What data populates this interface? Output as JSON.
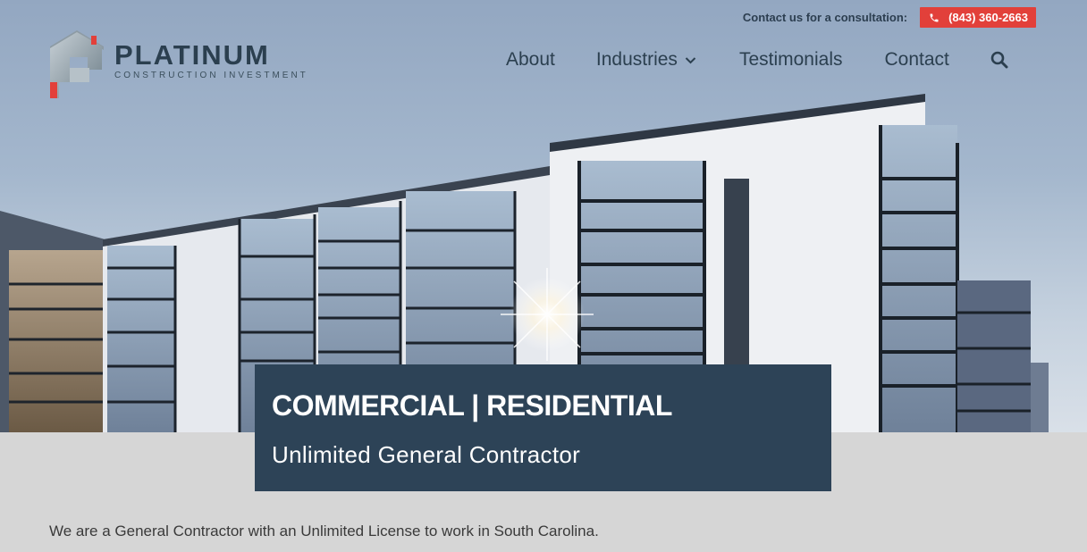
{
  "topbar": {
    "consult_text": "Contact us for a consultation:",
    "phone": "(843) 360-2663",
    "phone_icon": "phone-icon",
    "accent_color": "#e2403a"
  },
  "logo": {
    "name": "PLATINUM",
    "tagline": "CONSTRUCTION INVESTMENT"
  },
  "nav": {
    "items": [
      {
        "label": "About"
      },
      {
        "label": "Industries",
        "icon": "chevron-down-icon"
      },
      {
        "label": "Testimonials"
      },
      {
        "label": "Contact"
      }
    ],
    "search_icon": "search-icon"
  },
  "hero": {
    "image": "apartment-building-photo",
    "banner_title": "COMMERCIAL | RESIDENTIAL",
    "banner_subtitle": "Unlimited General Contractor",
    "banner_color": "#2d4357"
  },
  "intro": {
    "text": "We are a General Contractor with an Unlimited License to work in South Carolina."
  }
}
